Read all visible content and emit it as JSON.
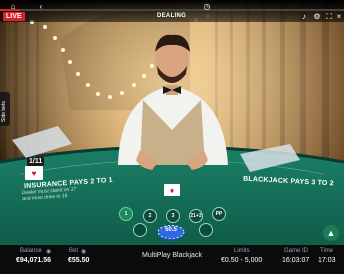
{
  "top_bar": {
    "live_badge": "LIVE",
    "status": "DEALING"
  },
  "side_bets_tab": "Side bets",
  "table": {
    "insurance_title": "INSURANCE PAYS 2 TO 1",
    "insurance_note": "Dealer must stand on 17 and must draw to 16",
    "blackjack_pays": "BLACKJACK PAYS 3 TO 2",
    "card_count_badge": "1/11"
  },
  "bet_spots": [
    "1",
    "2",
    "3",
    "21+3",
    "PP"
  ],
  "chip_value": "50.5",
  "bottom_bar": {
    "balance_label": "Balance",
    "balance_value": "€94,071.56",
    "bet_label": "Bet",
    "bet_value": "€55.50",
    "table_name": "MultiPlay Blackjack",
    "limits_label": "Limits",
    "limits_value": "€0.50 - 5,000",
    "game_id_label": "Game ID",
    "game_id_value": "16:03:07",
    "time_label": "Time",
    "time_value": "17:03"
  },
  "icons": {
    "top_left": [
      "home-icon",
      "back-icon"
    ],
    "top_right": [
      "history-icon",
      "sound-icon",
      "settings-icon",
      "fullscreen-icon",
      "close-icon"
    ],
    "bottom": [
      "eye-icon",
      "eye-icon",
      "chat-icon",
      "help-icon"
    ]
  },
  "colors": {
    "felt": "#14705a",
    "live_red": "#d8232a",
    "accent_green": "#1f7a56"
  }
}
